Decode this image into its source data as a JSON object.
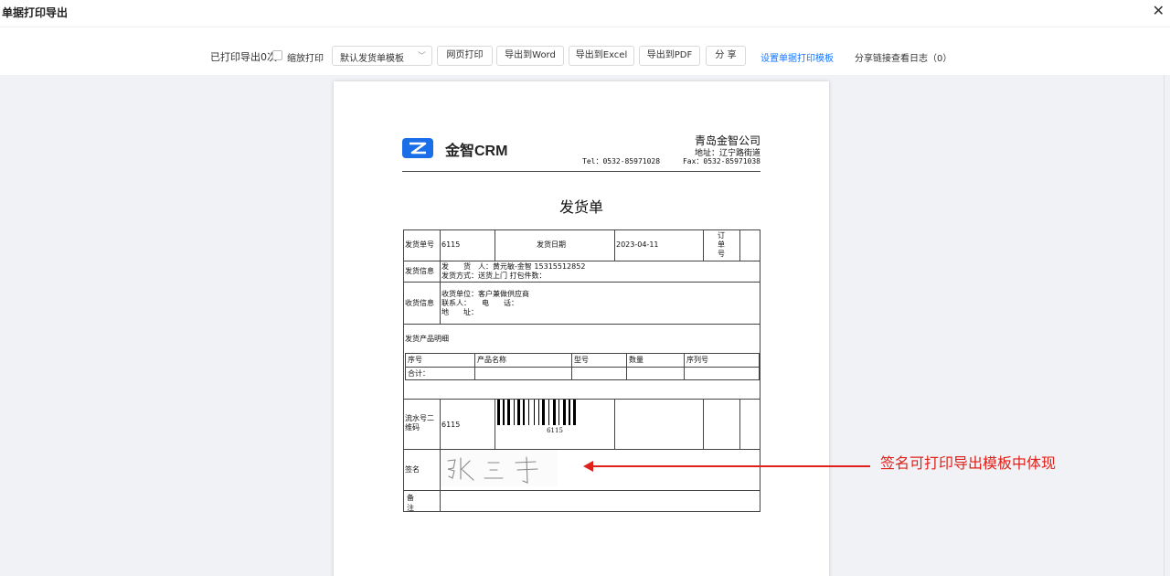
{
  "window": {
    "title": "单据打印导出",
    "close_label": "✕"
  },
  "toolbar": {
    "print_count": "已打印导出0次",
    "zoom_print": "缩放打印",
    "template_select": "默认发货单模板",
    "web_print": "网页打印",
    "export_word": "导出到Word",
    "export_excel": "导出到Excel",
    "export_pdf": "导出到PDF",
    "share": "分 享",
    "set_template": "设置单据打印模板",
    "share_log": "分享链接查看日志（0）"
  },
  "document": {
    "logo_text": "金智CRM",
    "company_name": "青岛金智公司",
    "address": "地址：辽宁路街道",
    "tel": "Tel：0532-85971028",
    "fax": "Fax：0532-85971038",
    "title": "发货单",
    "rows": {
      "order_no_label": "发货单号",
      "order_no": "6115",
      "date_label": "发货日期",
      "date": "2023-04-11",
      "order_label": "订单号",
      "ship_info_label": "发货信息",
      "shipper": "发　　货　人：黄元敏-金智 15315512852",
      "ship_method": "发货方式：送货上门 打包件数：",
      "recv_info_label": "收货信息",
      "recv_unit": "收货单位：客户兼做供应商",
      "contact": "联系人：　　电　　话：",
      "addr": "地　　址：",
      "detail_label": "发货产品明细",
      "serial_label": "流水号二维码",
      "serial_value": "6115",
      "barcode_text": "6115",
      "sign_label": "签名",
      "remark_label": "备注"
    },
    "detail_columns": [
      "序号",
      "产品名称",
      "型号",
      "数量",
      "序列号"
    ],
    "total_label": "合计："
  },
  "annotation": {
    "text": "签名可打印导出模板中体现"
  }
}
